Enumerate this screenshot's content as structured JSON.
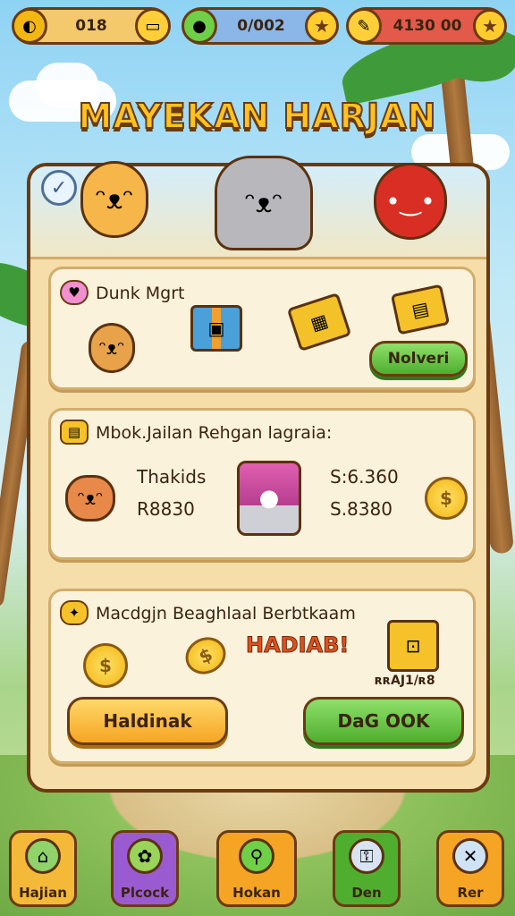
{
  "resources": [
    {
      "value": "018",
      "icon": "gold-coin-icon"
    },
    {
      "value": "0/002",
      "icon": "green-potion-icon"
    },
    {
      "value": "4130 00",
      "icon": "key-icon"
    }
  ],
  "title": "MAYEKAN HARJAN",
  "card1": {
    "title": "Dunk Mgrt",
    "button": "Nolveri"
  },
  "card2": {
    "title": "Mbok.Jailan Rehgan lagraia:",
    "stat_a1": "Thakids",
    "stat_a2": "R8830",
    "stat_b1": "S:6.360",
    "stat_b2": "S.8380"
  },
  "card3": {
    "title": "Macdgjn Beaghlaal Berbtkaam",
    "reward": "HADIAB!",
    "chest_label": "ʀʀAJ1/ʀ8",
    "button_left": "Haldinak",
    "button_right": "DaG OOK"
  },
  "nav": [
    {
      "label": "Hajian",
      "color": "#f5b93a"
    },
    {
      "label": "Plcock",
      "color": "#9b5bd0"
    },
    {
      "label": "Hokan",
      "color": "#f5a523"
    },
    {
      "label": "Den",
      "color": "#4fae2e"
    },
    {
      "label": "Rer",
      "color": "#f5a523"
    }
  ],
  "colors": {
    "panel": "#f6deaa",
    "border": "#6a3b12",
    "accent": "#ffc21e"
  }
}
